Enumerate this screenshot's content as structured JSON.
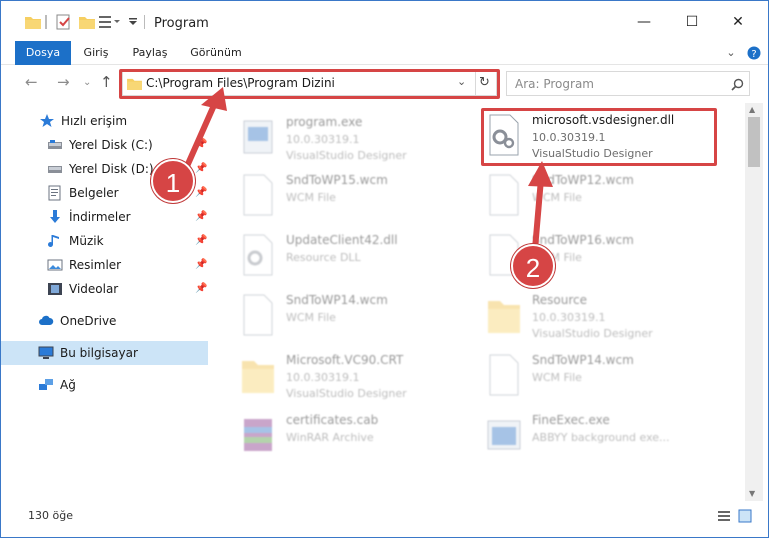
{
  "window": {
    "title": "Program",
    "minimize": "—",
    "maximize": "☐",
    "close": "✕"
  },
  "ribbon": {
    "tabs": [
      {
        "label": "Dosya"
      },
      {
        "label": "Giriş"
      },
      {
        "label": "Paylaş"
      },
      {
        "label": "Görünüm"
      }
    ]
  },
  "address": {
    "path": "C:\\Program Files\\Program Dizini",
    "refresh_icon": "refresh-icon"
  },
  "search": {
    "placeholder": "Ara: Program"
  },
  "sidebar": {
    "items": [
      {
        "label": "Hızlı erişim",
        "icon": "star-icon"
      },
      {
        "label": "Yerel Disk (C:)",
        "icon": "drive-icon"
      },
      {
        "label": "Yerel Disk (D:)",
        "icon": "drive-icon"
      },
      {
        "label": "Belgeler",
        "icon": "documents-icon"
      },
      {
        "label": "İndirmeler",
        "icon": "download-icon"
      },
      {
        "label": "Müzik",
        "icon": "music-icon"
      },
      {
        "label": "Resimler",
        "icon": "pictures-icon"
      },
      {
        "label": "Videolar",
        "icon": "video-icon"
      },
      {
        "label": "OneDrive",
        "icon": "cloud-icon"
      },
      {
        "label": "Bu bilgisayar",
        "icon": "computer-icon"
      },
      {
        "label": "Ağ",
        "icon": "network-icon"
      }
    ]
  },
  "files": [
    {
      "name": "program.exe",
      "line1": "10.0.30319.1",
      "line2": "VisualStudio Designer"
    },
    {
      "name": "microsoft.vsdesigner.dll",
      "line1": "10.0.30319.1",
      "line2": "VisualStudio Designer"
    },
    {
      "name": "SndToWP15.wcm",
      "line1": "WCM File",
      "line2": ""
    },
    {
      "name": "SndToWP12.wcm",
      "line1": "WCM File",
      "line2": ""
    },
    {
      "name": "UpdateClient42.dll",
      "line1": "Resource DLL",
      "line2": ""
    },
    {
      "name": "SndToWP16.wcm",
      "line1": "WCM File",
      "line2": ""
    },
    {
      "name": "SndToWP14.wcm",
      "line1": "WCM File",
      "line2": ""
    },
    {
      "name": "Resource",
      "line1": "10.0.30319.1",
      "line2": "VisualStudio Designer"
    },
    {
      "name": "Microsoft.VC90.CRT",
      "line1": "10.0.30319.1",
      "line2": "VisualStudio Designer"
    },
    {
      "name": "SndToWP14.wcm",
      "line1": "WCM File",
      "line2": ""
    },
    {
      "name": "certificates.cab",
      "line1": "WinRAR Archive",
      "line2": ""
    },
    {
      "name": "FineExec.exe",
      "line1": "ABBYY background exe...",
      "line2": ""
    }
  ],
  "status": {
    "count": "130 öğe"
  },
  "annotations": {
    "badge1": "1",
    "badge2": "2"
  },
  "colors": {
    "accent": "#1c70c8",
    "highlight": "#d64545",
    "selected": "#cce4f7"
  }
}
